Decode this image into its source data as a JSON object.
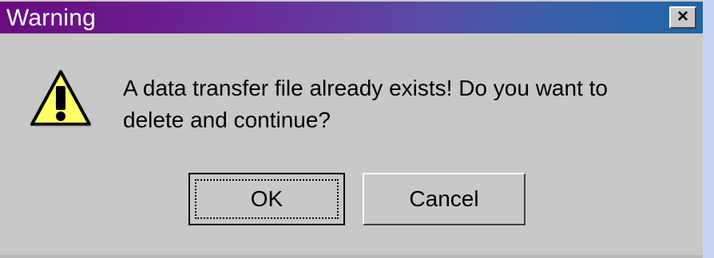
{
  "dialog": {
    "title": "Warning",
    "close_label": "×",
    "message_line_1": "A data transfer file already exists! Do you want to",
    "message_line_2": "delete and continue?",
    "buttons": {
      "ok_label": "OK",
      "cancel_label": "Cancel"
    },
    "icon": "warning-icon"
  },
  "colors": {
    "titlebar_start": "#6a0b7f",
    "titlebar_end": "#1f66a8",
    "dialog_bg": "#c8c8c8",
    "warning_yellow": "#ffff66"
  }
}
